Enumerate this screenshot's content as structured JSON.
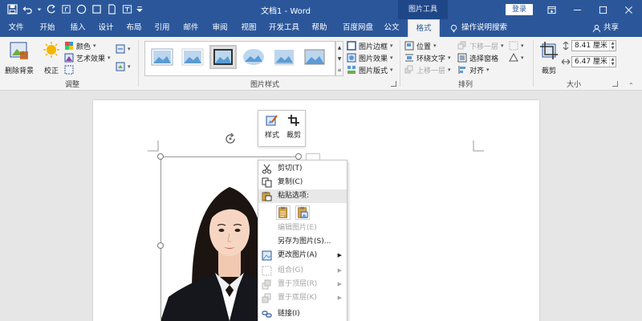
{
  "titlebar": {
    "doc_title": "文档1  -  Word",
    "context_tab_header": "图片工具",
    "login_label": "登录",
    "bg_color": "#2b579a"
  },
  "tabs": [
    {
      "label": "文件"
    },
    {
      "label": "开始"
    },
    {
      "label": "插入"
    },
    {
      "label": "设计"
    },
    {
      "label": "布局"
    },
    {
      "label": "引用"
    },
    {
      "label": "邮件"
    },
    {
      "label": "审阅"
    },
    {
      "label": "视图"
    },
    {
      "label": "开发工具"
    },
    {
      "label": "帮助"
    },
    {
      "label": "百度网盘"
    },
    {
      "label": "公文"
    },
    {
      "label": "格式"
    }
  ],
  "tell_me": "操作说明搜索",
  "share": "共享",
  "ribbon": {
    "remove_bg": "删除背景",
    "correct": "校正",
    "color": "颜色",
    "art_effect": "艺术效果",
    "group_adjust": "调整",
    "group_picture_styles": "图片样式",
    "picture_border": "图片边框",
    "picture_effects": "图片效果",
    "picture_layout": "图片版式",
    "position": "位置",
    "wrap_text": "环绕文字",
    "bring_forward": "上移一层",
    "send_backward": "下移一层",
    "selection_pane": "选择窗格",
    "align": "对齐",
    "group_arrange": "排列",
    "crop": "裁剪",
    "height": "8.41 厘米",
    "width": "6.47 厘米",
    "group_size": "大小"
  },
  "mini_toolbar": {
    "style": "样式",
    "crop": "裁剪"
  },
  "context_menu": {
    "items": [
      {
        "label": "剪切(T)",
        "disabled": false,
        "icon": "scissors-icon"
      },
      {
        "label": "复制(C)",
        "disabled": false,
        "icon": "copy-icon"
      },
      {
        "label": "粘贴选项:",
        "disabled": false,
        "icon": "paste-icon"
      },
      {
        "label": "编辑图片(E)",
        "disabled": true,
        "icon": ""
      },
      {
        "label": "另存为图片(S)...",
        "disabled": false,
        "icon": ""
      },
      {
        "label": "更改图片(A)",
        "disabled": false,
        "icon": "change-picture-icon",
        "submenu": true
      },
      {
        "label": "组合(G)",
        "disabled": true,
        "icon": "group-icon",
        "submenu": true
      },
      {
        "label": "置于顶层(R)",
        "disabled": true,
        "icon": "bring-to-front-icon",
        "submenu": true
      },
      {
        "label": "置于底层(K)",
        "disabled": true,
        "icon": "send-to-back-icon",
        "submenu": true
      },
      {
        "label": "链接(I)",
        "disabled": false,
        "icon": "link-icon"
      }
    ]
  }
}
